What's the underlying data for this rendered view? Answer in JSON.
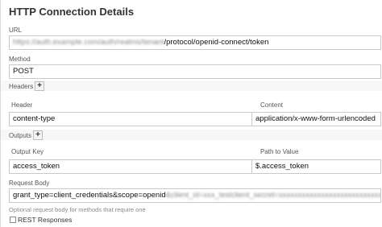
{
  "panel": {
    "title": "HTTP Connection Details"
  },
  "url": {
    "label": "URL",
    "value_hidden": "https://auth.example.com/auth/realms/tenant",
    "value_visible": "/protocol/openid-connect/token"
  },
  "method": {
    "label": "Method",
    "value": "POST"
  },
  "headers": {
    "label": "Headers",
    "add_label": "+",
    "col_header": "Header",
    "col_content": "Content",
    "rows": [
      {
        "header": "content-type",
        "content": "application/x-www-form-urlencoded"
      }
    ]
  },
  "outputs": {
    "label": "Outputs",
    "add_label": "+",
    "col_key": "Output Key",
    "col_path": "Path to Value",
    "rows": [
      {
        "key": "access_token",
        "path": "$.access_token"
      }
    ]
  },
  "request_body": {
    "label": "Request Body",
    "value_visible": "grant_type=client_credentials&scope=openid",
    "value_hidden": "&client_id=xxx_testclient_secret=xxxxxxxxxxxxxxxxxxxxxxxxxxxxxxx",
    "hint": "Optional request body for methods that require one"
  },
  "rest_responses": {
    "label": "REST Responses",
    "checked": false
  }
}
